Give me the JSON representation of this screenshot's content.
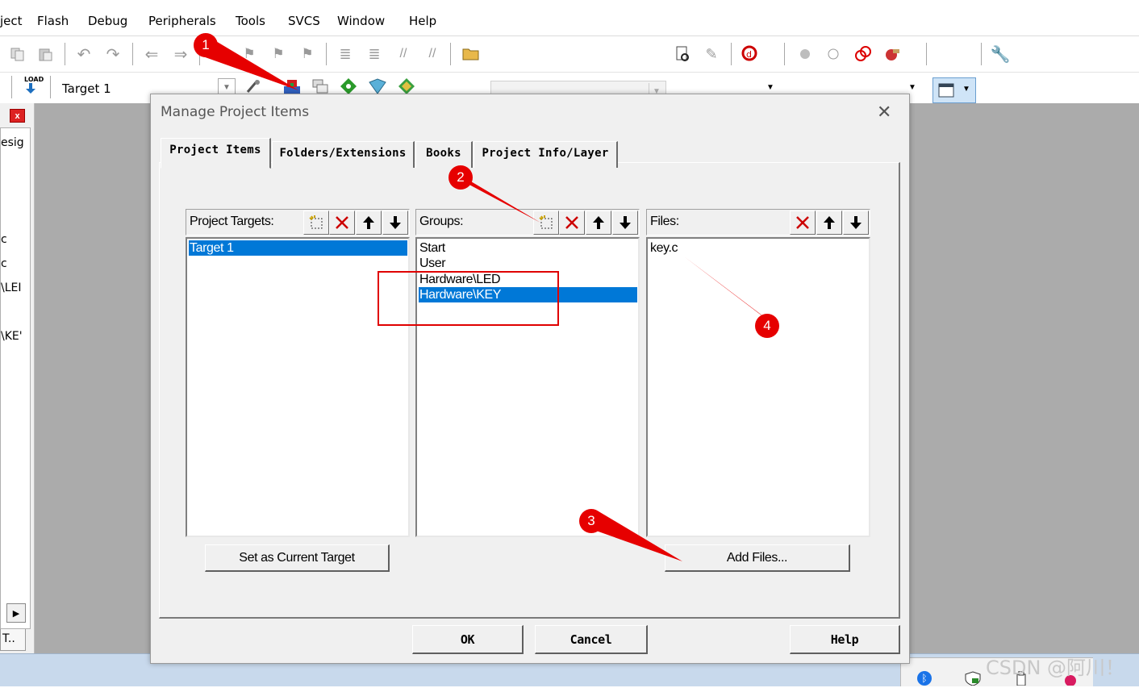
{
  "menu": [
    "ject",
    "Flash",
    "Debug",
    "Peripherals",
    "Tools",
    "SVCS",
    "Window",
    "Help"
  ],
  "toolbar2": {
    "load_label": "LOAD",
    "target_name": "Target 1"
  },
  "left_pane": {
    "close_glyph": "x",
    "items": [
      "esig",
      "c",
      "c",
      "\\LEI",
      "\\KE'"
    ],
    "bottom_label": "T.."
  },
  "dialog": {
    "title": "Manage Project Items",
    "tabs": [
      "Project Items",
      "Folders/Extensions",
      "Books",
      "Project Info/Layer"
    ],
    "active_tab": 0,
    "targets": {
      "label": "Project Targets:",
      "items": [
        "Target 1"
      ],
      "selected": 0
    },
    "groups": {
      "label": "Groups:",
      "items": [
        "Start",
        "User",
        "Hardware\\LED",
        "Hardware\\KEY"
      ],
      "selected": 3
    },
    "files": {
      "label": "Files:",
      "items": [
        "key.c"
      ]
    },
    "set_current_label": "Set as Current Target",
    "add_files_label": "Add Files...",
    "ok_label": "OK",
    "cancel_label": "Cancel",
    "help_label": "Help"
  },
  "annotations": {
    "markers": [
      "1",
      "2",
      "3",
      "4"
    ],
    "color": "#e60000"
  },
  "watermark": "CSDN @阿川！",
  "colors": {
    "selection": "#0078d7",
    "workspace": "#ababab",
    "dialog_bg": "#f0f0f0"
  }
}
